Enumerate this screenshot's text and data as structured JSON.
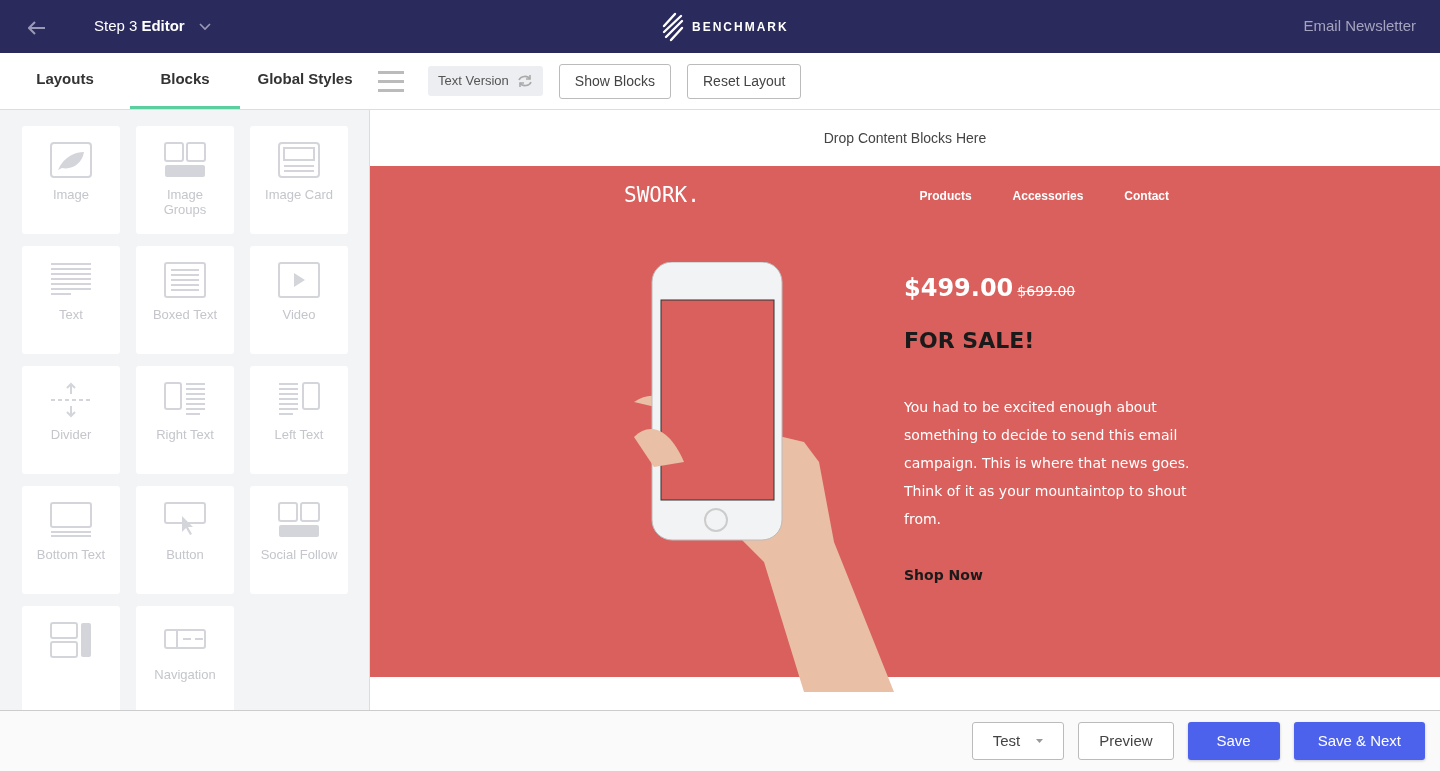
{
  "header": {
    "step": "Step 3",
    "title": "Editor",
    "brand": "BENCHMARK",
    "campaign_type": "Email Newsletter"
  },
  "tabs": [
    {
      "label": "Layouts",
      "selected": false
    },
    {
      "label": "Blocks",
      "selected": true
    },
    {
      "label": "Global Styles",
      "selected": false
    }
  ],
  "toolbar": {
    "text_version": "Text Version",
    "buttons": [
      "Show Blocks",
      "Reset Layout"
    ]
  },
  "blocks": [
    {
      "label": "Image",
      "kind": "image"
    },
    {
      "label": "Image Groups",
      "kind": "image-groups"
    },
    {
      "label": "Image Card",
      "kind": "image-card"
    },
    {
      "label": "Text",
      "kind": "text"
    },
    {
      "label": "Boxed Text",
      "kind": "boxed-text"
    },
    {
      "label": "Video",
      "kind": "video"
    },
    {
      "label": "Divider",
      "kind": "divider"
    },
    {
      "label": "Right Text",
      "kind": "right-text"
    },
    {
      "label": "Left Text",
      "kind": "left-text"
    },
    {
      "label": "Bottom Text",
      "kind": "bottom-text"
    },
    {
      "label": "Button",
      "kind": "button"
    },
    {
      "label": "Social Follow",
      "kind": "social-follow"
    },
    {
      "kind": "social-share"
    },
    {
      "label": "Navigation",
      "kind": "navigation"
    }
  ],
  "canvas": {
    "drop_hint": "Drop Content Blocks Here",
    "email": {
      "logo": "SWORK.",
      "nav": [
        "Products",
        "Accessories",
        "Contact"
      ],
      "price": "$499.00",
      "old_price": "$699.00",
      "headline": "FOR SALE!",
      "body": "You had to be excited enough about something to decide to send this email campaign. This is where that news goes. Think of it as your mountaintop to shout from.",
      "cta": "Shop Now"
    }
  },
  "footer": {
    "buttons": [
      {
        "label": "Test",
        "kind": "dropdown"
      },
      {
        "label": "Preview",
        "kind": "outline"
      },
      {
        "label": "Save",
        "kind": "primary"
      },
      {
        "label": "Save & Next",
        "kind": "primary"
      }
    ]
  }
}
